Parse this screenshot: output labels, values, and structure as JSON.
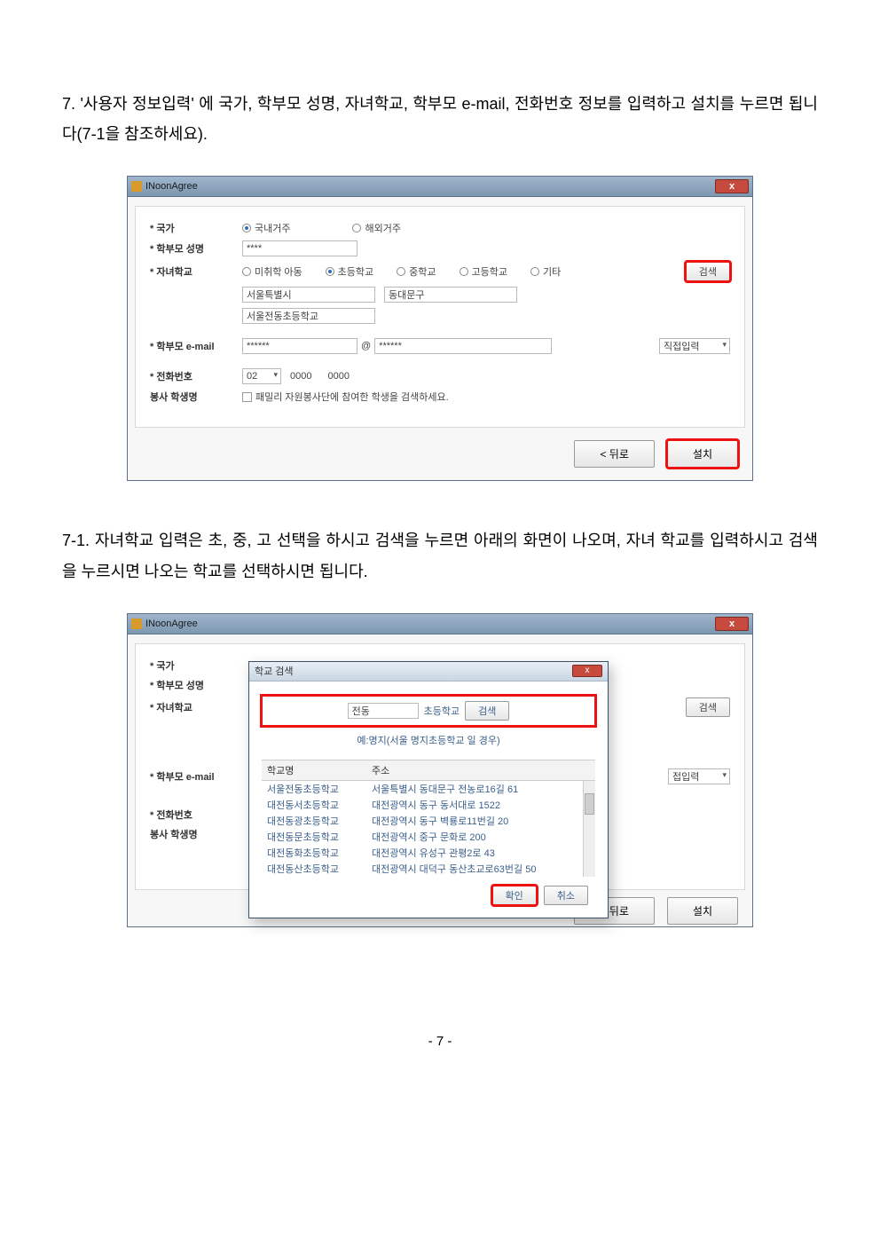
{
  "instructions": {
    "step7_num": "7.",
    "step7_text": "'사용자 정보입력' 에 국가, 학부모 성명, 자녀학교, 학부모 e-mail, 전화번호 정보를 입력하고 설치를 누르면 됩니다(7-1을 참조하세요).",
    "step71_num": "7-1.",
    "step71_text": "자녀학교 입력은 초, 중, 고 선택을 하시고 검색을 누르면 아래의 화면이 나오며, 자녀 학교를 입력하시고 검색을 누르시면 나오는 학교를 선택하시면 됩니다."
  },
  "dialog1": {
    "title": "INoonAgree",
    "close": "x",
    "labels": {
      "country": "* 국가",
      "parent_name": "* 학부모 성명",
      "child_school": "* 자녀학교",
      "parent_email": "* 학부모 e-mail",
      "phone": "* 전화번호",
      "volunteer": "봉사 학생명"
    },
    "country_opts": {
      "domestic": "국내거주",
      "overseas": "해외거주"
    },
    "parent_name_value": "****",
    "school_level": {
      "preschool": "미취학 아동",
      "elementary": "초등학교",
      "middle": "중학교",
      "high": "고등학교",
      "etc": "기타"
    },
    "search_btn": "검색",
    "region1": "서울특별시",
    "region2": "동대문구",
    "school_name": "서울전동초등학교",
    "email_local": "******",
    "email_at": "@",
    "email_domain": "******",
    "email_select": "직접입력",
    "phone_area": "02",
    "phone_mid": "0000",
    "phone_last": "0000",
    "volunteer_hint": "패밀리 자원봉사단에 참여한 학생을 검색하세요.",
    "back_btn": "< 뒤로",
    "install_btn": "설치"
  },
  "dialog2": {
    "title": "INoonAgree",
    "close": "x",
    "labels": {
      "country": "* 국가",
      "parent_name": "* 학부모 성명",
      "child_school": "* 자녀학교",
      "parent_email": "* 학부모 e-mail",
      "phone": "* 전화번호",
      "volunteer": "봉사 학생명"
    },
    "search_btn": "검색",
    "email_select": "접입력",
    "back_btn": "< 뒤로",
    "install_btn": "설치",
    "popup": {
      "title": "학교 검색",
      "close": "x",
      "input": "전동",
      "level": "초등학교",
      "search": "검색",
      "hint": "예:명지(서울 명지초등학교 일 경우)",
      "head_name": "학교명",
      "head_addr": "주소",
      "rows": [
        {
          "name": "서울전동초등학교",
          "addr": "서울특별시 동대문구 전농로16길 61"
        },
        {
          "name": "대전동서초등학교",
          "addr": "대전광역시 동구 동서대로 1522"
        },
        {
          "name": "대전동광초등학교",
          "addr": "대전광역시 동구 벽룡로11번길 20"
        },
        {
          "name": "대전동문초등학교",
          "addr": "대전광역시 중구 문화로 200"
        },
        {
          "name": "대전동화초등학교",
          "addr": "대전광역시 유성구 관평2로 43"
        },
        {
          "name": "대전동산초등학교",
          "addr": "대전광역시 대덕구 동산초교로63번길 50"
        }
      ],
      "ok": "확인",
      "cancel": "취소"
    }
  },
  "page_number": "- 7 -"
}
